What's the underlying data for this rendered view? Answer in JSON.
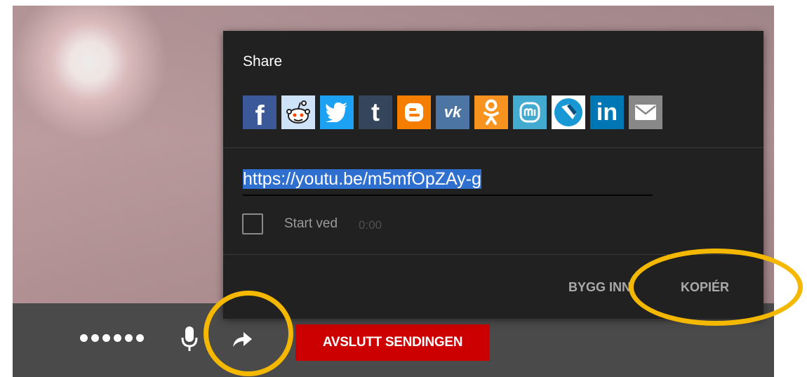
{
  "share_dialog": {
    "title": "Share",
    "url": "https://youtu.be/m5mfOpZAy-g",
    "start_label": "Start ved",
    "start_time": "0:00",
    "embed_label": "BYGG INN",
    "copy_label": "KOPIÉR",
    "platforms": [
      {
        "name": "facebook-icon",
        "glyph": "f",
        "color": "#3b5998"
      },
      {
        "name": "reddit-icon",
        "glyph": "",
        "color": "#cee3f8"
      },
      {
        "name": "twitter-icon",
        "glyph": "",
        "color": "#1da1f2"
      },
      {
        "name": "tumblr-icon",
        "glyph": "t",
        "color": "#35465c"
      },
      {
        "name": "blogger-icon",
        "glyph": "B",
        "color": "#f57d00"
      },
      {
        "name": "vk-icon",
        "glyph": "vk",
        "color": "#4c75a3"
      },
      {
        "name": "odnoklassniki-icon",
        "glyph": "",
        "color": "#f7931e"
      },
      {
        "name": "mixi-icon",
        "glyph": "",
        "color": "#43aad0"
      },
      {
        "name": "goo-icon",
        "glyph": "",
        "color": "#1899d6"
      },
      {
        "name": "linkedin-icon",
        "glyph": "in",
        "color": "#0077b5"
      },
      {
        "name": "email-icon",
        "glyph": "",
        "color": "#888888"
      }
    ]
  },
  "controls": {
    "end_stream_label": "AVSLUTT SENDINGEN"
  },
  "colors": {
    "highlight": "#f5b800",
    "end_button": "#cc0000",
    "dialog_bg": "#212121"
  }
}
